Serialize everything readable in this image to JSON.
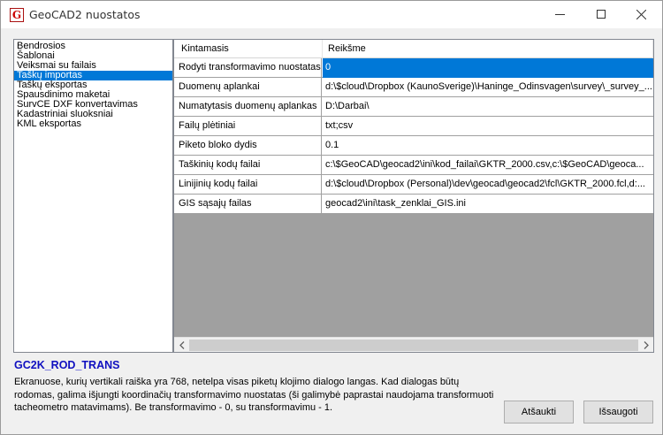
{
  "window": {
    "title": "GeoCAD2 nuostatos",
    "icon_letter": "G"
  },
  "sidebar": {
    "items": [
      {
        "label": "Bendrosios"
      },
      {
        "label": "Šablonai"
      },
      {
        "label": "Veiksmai su failais"
      },
      {
        "label": "Taškų importas",
        "selected": true
      },
      {
        "label": "Taškų eksportas"
      },
      {
        "label": "Spausdinimo maketai"
      },
      {
        "label": "SurvCE DXF konvertavimas"
      },
      {
        "label": "Kadastriniai sluoksniai"
      },
      {
        "label": "KML eksportas"
      }
    ]
  },
  "grid": {
    "columns": [
      "Kintamasis",
      "Reikšme"
    ],
    "rows": [
      {
        "name": "Rodyti transformavimo nuostatas",
        "value": "0",
        "selected": true
      },
      {
        "name": "Duomenų aplankai",
        "value": "d:\\$cloud\\Dropbox (KaunoSverige)\\Haninge_Odinsvagen\\survey\\_survey_..."
      },
      {
        "name": "Numatytasis duomenų aplankas",
        "value": "D:\\Darbai\\"
      },
      {
        "name": "Failų plėtiniai",
        "value": "txt;csv"
      },
      {
        "name": "Piketo bloko dydis",
        "value": "0.1"
      },
      {
        "name": "Taškinių kodų failai",
        "value": "c:\\$GeoCAD\\geocad2\\ini\\kod_failai\\GKTR_2000.csv,c:\\$GeoCAD\\geoca..."
      },
      {
        "name": "Linijinių kodų failai",
        "value": "d:\\$cloud\\Dropbox (Personal)\\dev\\geocad\\geocad2\\fcl\\GKTR_2000.fcl,d:..."
      },
      {
        "name": "GIS sąsajų failas",
        "value": "geocad2\\ini\\task_zenklai_GIS.ini"
      }
    ],
    "scroll_left_icon": "chevron-left",
    "scroll_right_icon": "chevron-right"
  },
  "description": {
    "title": "GC2K_ROD_TRANS",
    "lines": [
      "Ekranuose, kurių vertikali raiška yra 768, netelpa visas piketų klojimo dialogo langas. Kad dialogas būtų",
      "rodomas, galima išjungti koordinačių transformavimo nuostatas (ši galimybė paprastai naudojama transformuoti",
      "tacheometro matavimams). Be transformavimo - 0, su transformavimu - 1."
    ]
  },
  "buttons": {
    "cancel_label": "Atšaukti",
    "save_label": "Išsaugoti"
  },
  "colors": {
    "selection": "#0078d7",
    "description_title": "#1010c0"
  }
}
